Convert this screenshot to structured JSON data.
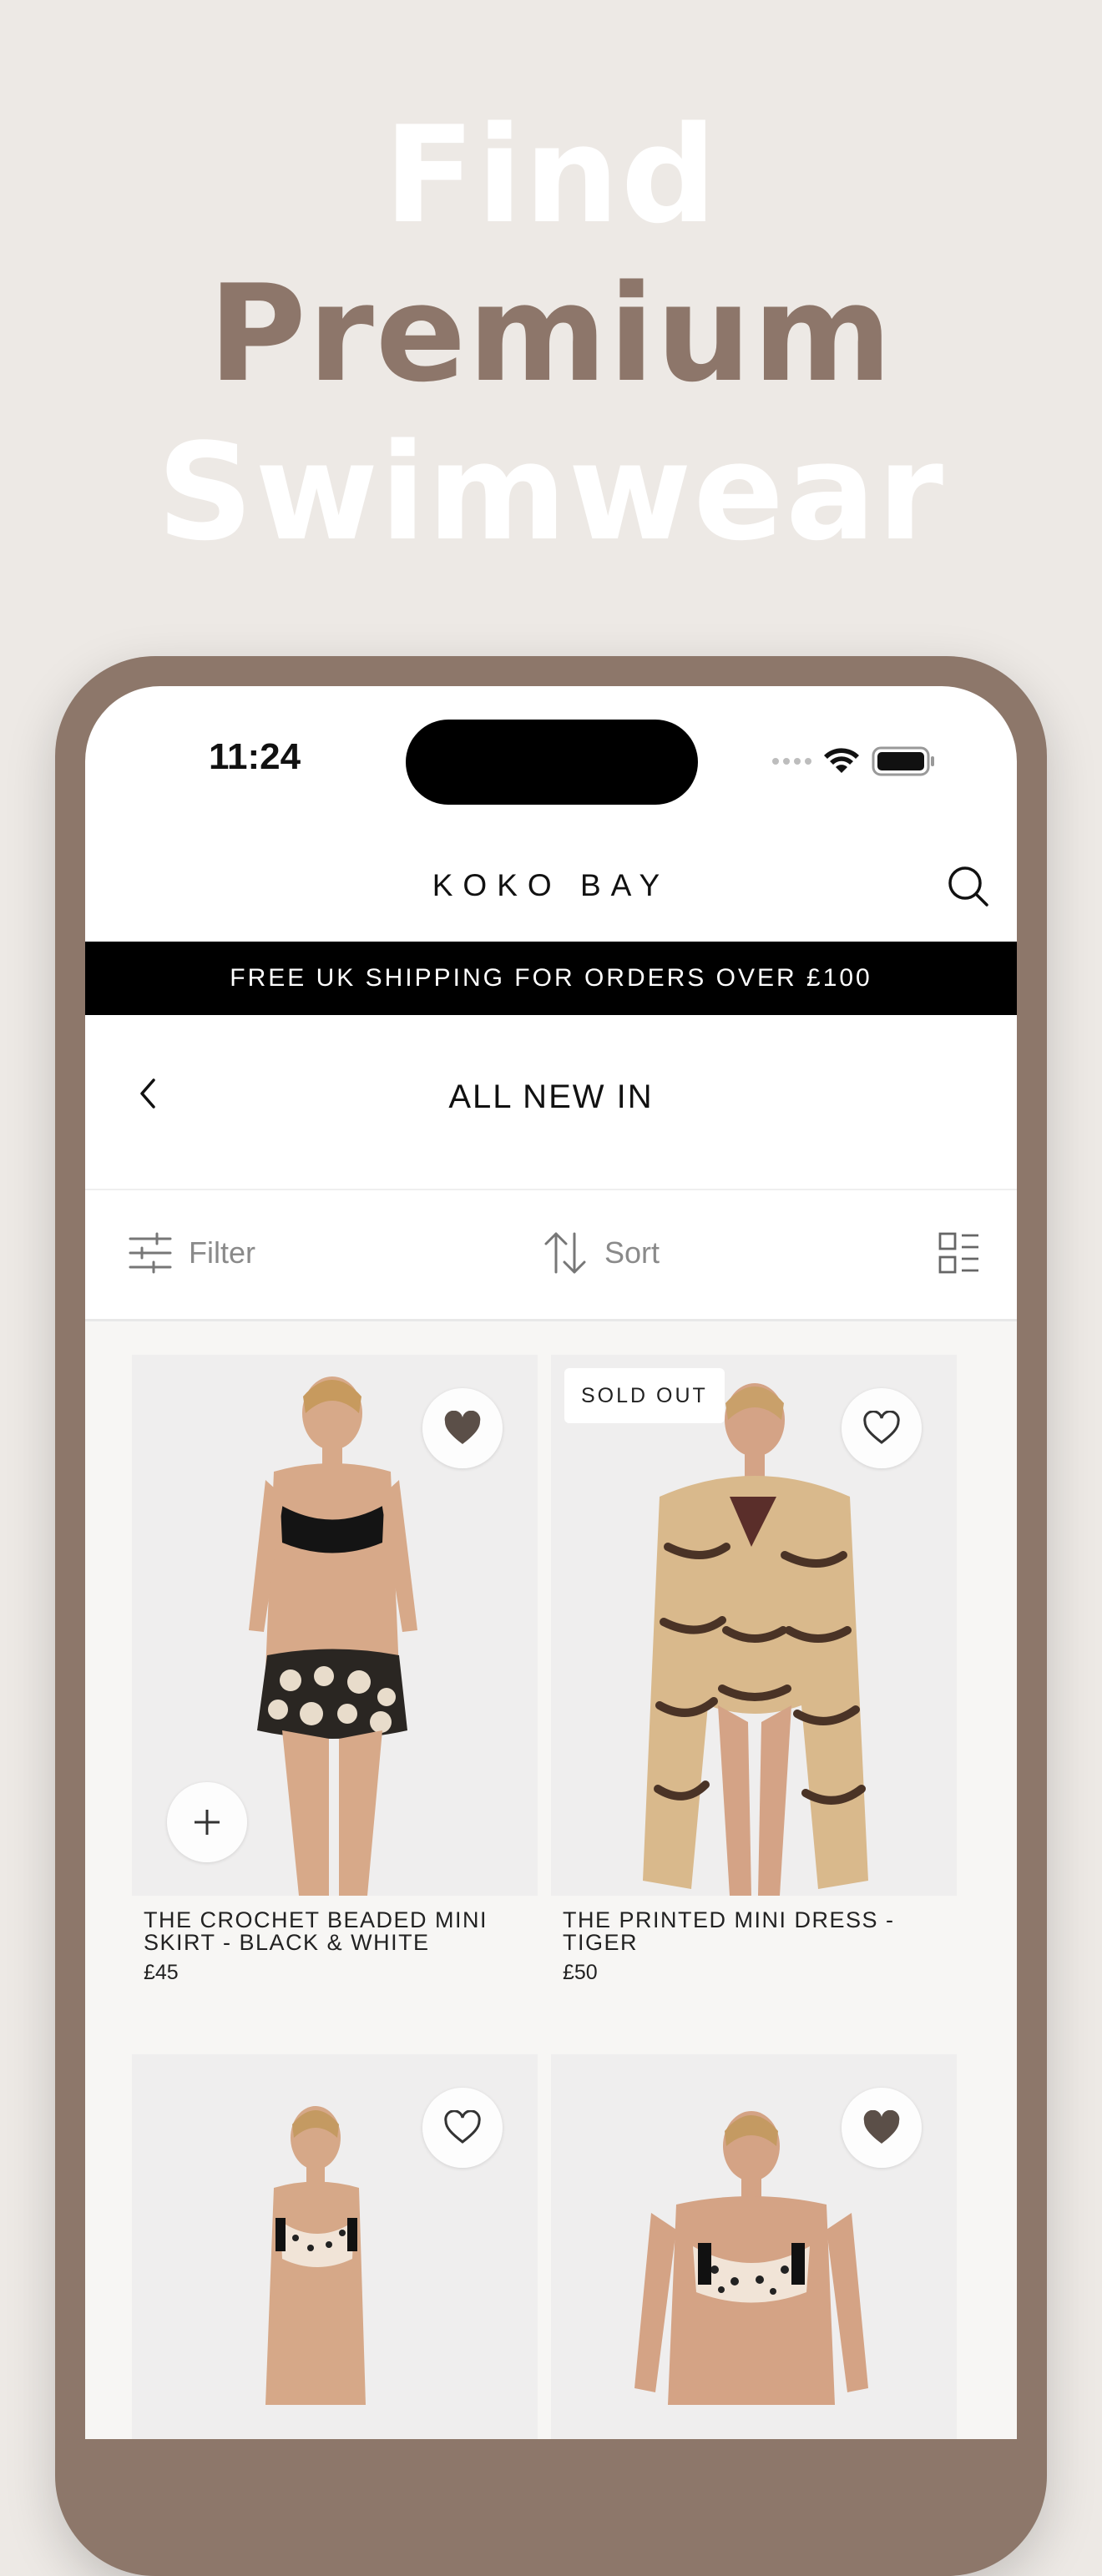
{
  "headline": {
    "line1": "Find",
    "line2": "Premium",
    "line3": "Swimwear"
  },
  "status_bar": {
    "time": "11:24"
  },
  "header": {
    "brand": "KOKO BAY"
  },
  "promo": {
    "text": "FREE UK SHIPPING FOR ORDERS OVER £100"
  },
  "page": {
    "title": "ALL NEW IN"
  },
  "toolbar": {
    "filter_label": "Filter",
    "sort_label": "Sort"
  },
  "products": [
    {
      "name": "THE CROCHET BEADED MINI SKIRT - BLACK & WHITE",
      "price": "£45",
      "badge": "",
      "favorited": true
    },
    {
      "name": "THE PRINTED MINI DRESS - TIGER",
      "price": "£50",
      "badge": "SOLD OUT",
      "favorited": false
    },
    {
      "name": "",
      "price": "",
      "badge": "",
      "favorited": false
    },
    {
      "name": "",
      "price": "",
      "badge": "",
      "favorited": true
    }
  ],
  "colors": {
    "accent": "#8d766a",
    "background": "#ede9e5",
    "promo_bar": "#000000"
  }
}
